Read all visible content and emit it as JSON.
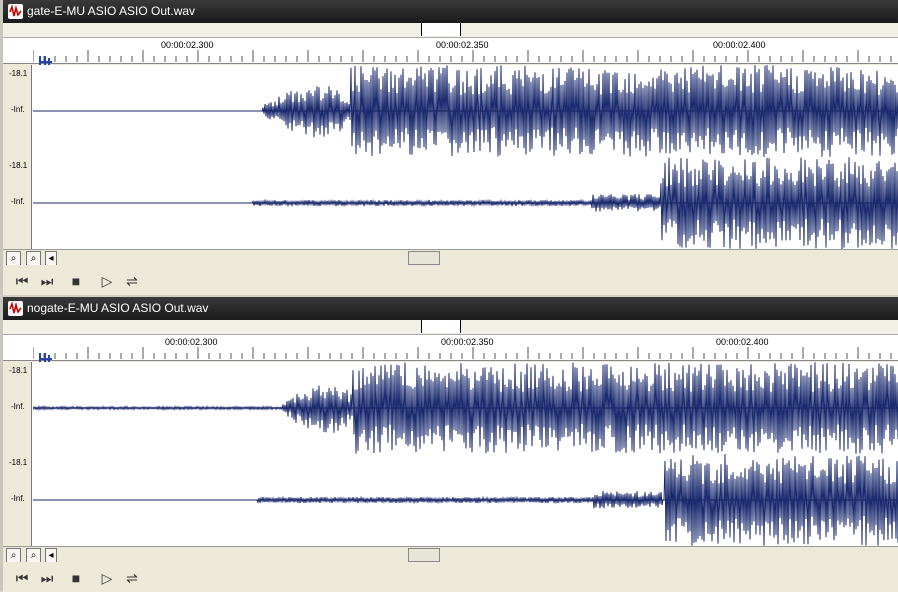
{
  "windows": [
    {
      "title": "gate-E-MU ASIO ASIO Out.wav",
      "ruler": [
        "00:00:02.300",
        "00:00:02.350",
        "00:00:02.400"
      ],
      "tracks": [
        {
          "db": "-18.1",
          "inf": "-Inf."
        },
        {
          "db": "-18.1",
          "inf": "-Inf."
        }
      ]
    },
    {
      "title": "nogate-E-MU ASIO ASIO Out.wav",
      "ruler": [
        "00:00:02.300",
        "00:00:02.350",
        "00:00:02.400"
      ],
      "tracks": [
        {
          "db": "-18.1",
          "inf": "-Inf."
        },
        {
          "db": "-18.1",
          "inf": "-Inf."
        }
      ]
    }
  ],
  "icons": {
    "zoom_in": "zoom-in-icon",
    "zoom_out": "zoom-out-icon",
    "scroll_left": "scroll-left-icon",
    "go_start": "go-to-start-icon",
    "go_end": "go-to-end-icon",
    "stop": "stop-icon",
    "play": "play-icon",
    "loop": "loop-icon"
  },
  "colors": {
    "waveform": "#1a2a6e",
    "title_bar": "#222222",
    "window_bg": "#ece9d8"
  }
}
